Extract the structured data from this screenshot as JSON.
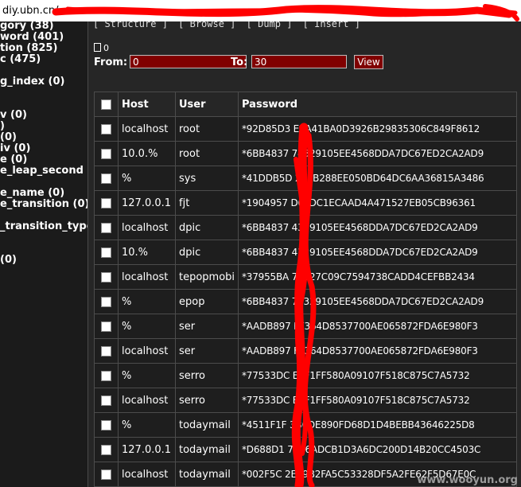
{
  "address_bar": {
    "url_visible": "diy.ubn.cn/"
  },
  "sidebar": {
    "items": [
      "gory (38)",
      "word (401)",
      "tion (825)",
      "c (475)",
      "g_index (0)",
      "",
      "v (0)",
      ")",
      "(0)",
      "iv (0)",
      "e (0)",
      "e_leap_second",
      "e_name (0)",
      "e_transition (0)",
      "_transition_type",
      "(0)"
    ]
  },
  "tabs": [
    "[ Structure ]",
    "[ Browse ]",
    "[ Dump ]",
    "[ Insert ]"
  ],
  "row_count": "0",
  "pager": {
    "from_label": "From:",
    "from_value": "0",
    "to_label": "To:",
    "to_value": "30",
    "view_label": "View"
  },
  "table": {
    "headers": [
      "Host",
      "User",
      "Password"
    ],
    "rows": [
      [
        "localhost",
        "root",
        "*92D85D3   E8A41BA0D3926B29835306C849F8612"
      ],
      [
        "10.0.%",
        "root",
        "*6BB4837   74329105EE4568DDA7DC67ED2CA2AD9"
      ],
      [
        "%",
        "sys",
        "*41DDB5D    213B288EE050BD64DC6AA36815A3486"
      ],
      [
        "127.0.0.1",
        "fjt",
        "*1904957    D6FDC1ECAAD4A471527EB05CB96361"
      ],
      [
        "localhost",
        "dpic",
        "*6BB4837   4329105EE4568DDA7DC67ED2CA2AD9"
      ],
      [
        "10.%",
        "dpic",
        "*6BB4837   4329105EE4568DDA7DC67ED2CA2AD9"
      ],
      [
        "localhost",
        "tepopmobi",
        "*37955BA   77827C09C7594738CADD4CEFBB2434"
      ],
      [
        "%",
        "epop",
        "*6BB4837   74329105EE4568DDA7DC67ED2CA2AD9"
      ],
      [
        "%",
        "ser",
        "*AADB897   FF364D8537700AE065872FDA6E980F3"
      ],
      [
        "localhost",
        "ser",
        "*AADB897   FF364D8537700AE065872FDA6E980F3"
      ],
      [
        "%",
        "serro",
        "*77533DC   E0F1FF580A09107F518C875C7A5732"
      ],
      [
        "localhost",
        "serro",
        "*77533DC   E0F1FF580A09107F518C875C7A5732"
      ],
      [
        "%",
        "todaymail",
        "*4511F1F   3B6DE890FD68D1D4BEBB43646225D8"
      ],
      [
        "127.0.0.1",
        "todaymail",
        "*D688D1   7346ADCB1D3A6DC200D14B20CC4503C"
      ],
      [
        "localhost",
        "todaymail",
        "*002F5C    2E99B2FA5C53328DF5A2FE62F5D67E0C"
      ]
    ]
  },
  "watermark": "www.wooyun.org",
  "colors": {
    "input_bg": "#800000",
    "scribble": "#ff0000",
    "page_bg": "#262626"
  }
}
